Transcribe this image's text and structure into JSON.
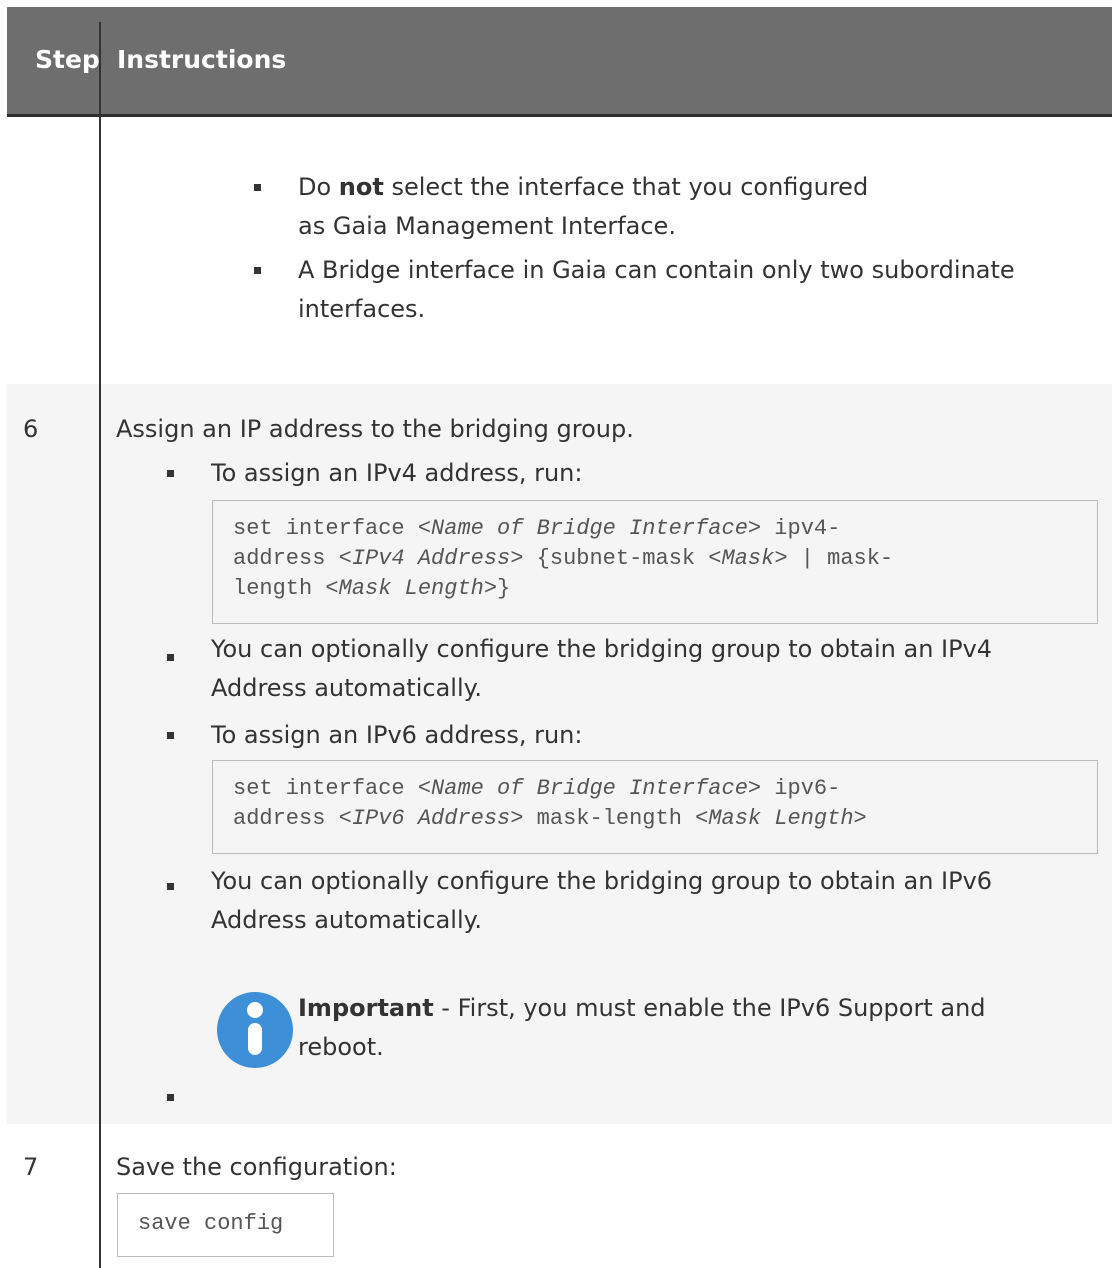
{
  "header": {
    "step": "Step",
    "instructions": "Instructions"
  },
  "step5": {
    "b1_pre": "Do ",
    "b1_bold": "not",
    "b1_post": " select the interface that you configured",
    "b1_line2": "as Gaia Management Interface.",
    "b2_line1": "A Bridge interface in Gaia can contain only two subordinate",
    "b2_line2": "interfaces."
  },
  "step6": {
    "number": "6",
    "intro": "Assign an IP address to the bridging group.",
    "ipv4_label": "To assign an IPv4 address, run:",
    "ipv4_code": {
      "l1_a": "set interface <",
      "l1_b": "Name of Bridge Interface",
      "l1_c": "> ipv4-",
      "l2_a": "address <",
      "l2_b": "IPv4 Address",
      "l2_c": "> {subnet-mask <",
      "l2_d": "Mask",
      "l2_e": "> | mask-",
      "l3_a": "length <",
      "l3_b": "Mask Length",
      "l3_c": ">}"
    },
    "ipv4_auto_l1": "You can optionally configure the bridging group to obtain an IPv4",
    "ipv4_auto_l2": "Address automatically.",
    "ipv6_label": "To assign an IPv6 address, run:",
    "ipv6_code": {
      "l1_a": "set interface <",
      "l1_b": "Name of Bridge Interface",
      "l1_c": "> ipv6-",
      "l2_a": "address <",
      "l2_b": "IPv6 Address",
      "l2_c": "> mask-length <",
      "l2_d": "Mask Length",
      "l2_e": ">"
    },
    "ipv6_auto_l1": "You can optionally configure the bridging group to obtain an IPv6",
    "ipv6_auto_l2": "Address automatically.",
    "important_bold": "Important",
    "important_rest": " - First, you must enable the IPv6 Support and",
    "important_l2": "reboot."
  },
  "step7": {
    "number": "7",
    "intro": "Save the configuration:",
    "code": "save config"
  },
  "colors": {
    "header_bg": "#6e6e6e",
    "info_blue": "#3d8fd8",
    "row_shade": "#f5f5f5"
  }
}
